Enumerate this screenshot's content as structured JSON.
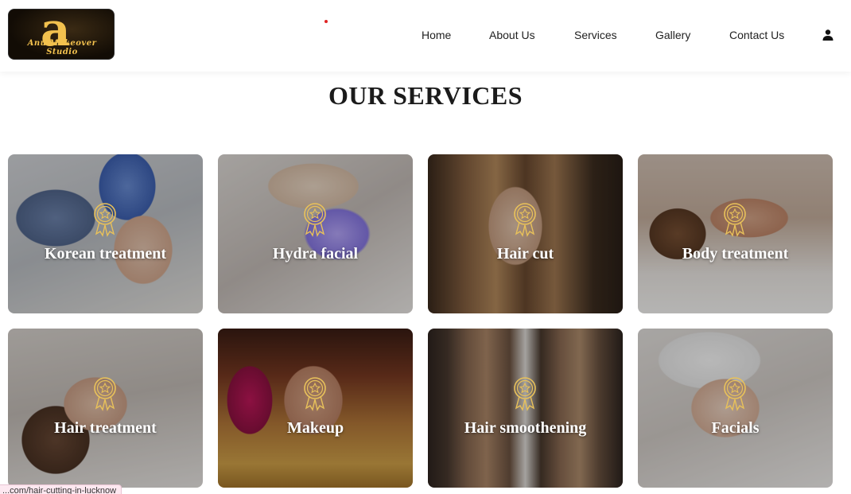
{
  "header": {
    "logo_letter": "a",
    "logo_text": "Anu Makeover Studio",
    "nav": [
      {
        "label": "Home"
      },
      {
        "label": "About Us"
      },
      {
        "label": "Services"
      },
      {
        "label": "Gallery"
      },
      {
        "label": "Contact Us"
      }
    ],
    "user_icon": "user-icon"
  },
  "section": {
    "title": "OUR SERVICES"
  },
  "services": [
    {
      "label": "Korean treatment",
      "icon": "award-badge-icon"
    },
    {
      "label": "Hydra facial",
      "icon": "award-badge-icon"
    },
    {
      "label": "Hair cut",
      "icon": "award-badge-icon"
    },
    {
      "label": "Body treatment",
      "icon": "award-badge-icon"
    },
    {
      "label": "Hair treatment",
      "icon": "award-badge-icon"
    },
    {
      "label": "Makeup",
      "icon": "award-badge-icon"
    },
    {
      "label": "Hair smoothening",
      "icon": "award-badge-icon"
    },
    {
      "label": "Facials",
      "icon": "award-badge-icon"
    }
  ],
  "status_bar": {
    "url": "...com/hair-cutting-in-lucknow"
  },
  "colors": {
    "badge_gold": "#e8c15a",
    "text_dark": "#1b1b1b",
    "logo_gold": "#f2c14e"
  }
}
